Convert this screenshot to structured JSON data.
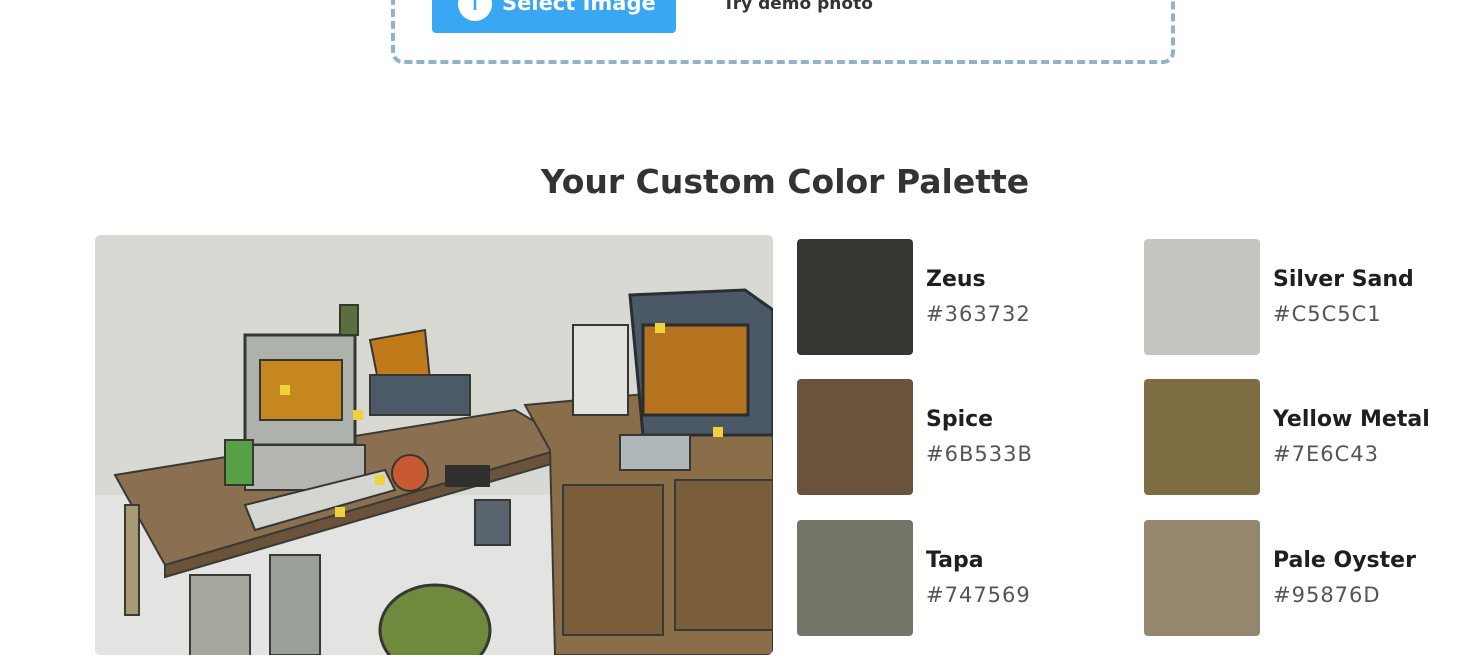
{
  "upload": {
    "select_label": "Select Image",
    "demo_label": "Try demo photo"
  },
  "palette": {
    "title": "Your Custom Color Palette",
    "colors": [
      {
        "name": "Zeus",
        "hex": "#363732"
      },
      {
        "name": "Silver Sand",
        "hex": "#C5C5C1"
      },
      {
        "name": "Spice",
        "hex": "#6B533B"
      },
      {
        "name": "Yellow Metal",
        "hex": "#7E6C43"
      },
      {
        "name": "Tapa",
        "hex": "#747569"
      },
      {
        "name": "Pale Oyster",
        "hex": "#95876D"
      }
    ]
  }
}
